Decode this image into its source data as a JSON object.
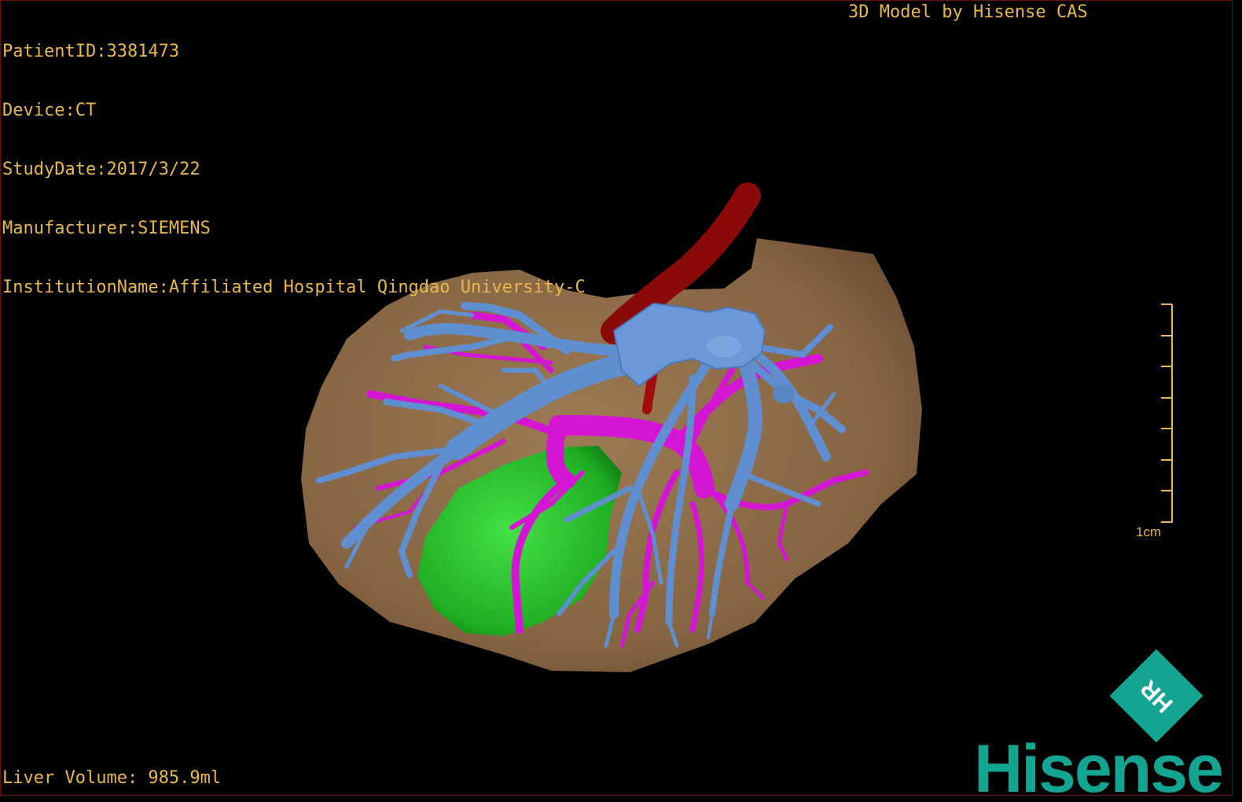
{
  "info": {
    "patient_id": "PatientID:3381473",
    "device": "Device:CT",
    "study_date": "StudyDate:2017/3/22",
    "manufacturer": "Manufacturer:SIEMENS",
    "institution": "InstitutionName:Affiliated Hospital Qingdao University-C"
  },
  "credit": "3D Model by Hisense CAS",
  "volume": "Liver Volume: 985.9ml",
  "scale_label": "1cm",
  "brand": {
    "name": "Hisense",
    "badge": "HR"
  },
  "colors": {
    "text": "#e8b84a",
    "liver": "#8b6a48",
    "portal_vein": "#5f8fd0",
    "hepatic_artery": "#d415d4",
    "aorta": "#8a0a0a",
    "tumor": "#22c026",
    "brand": "#13a492"
  }
}
